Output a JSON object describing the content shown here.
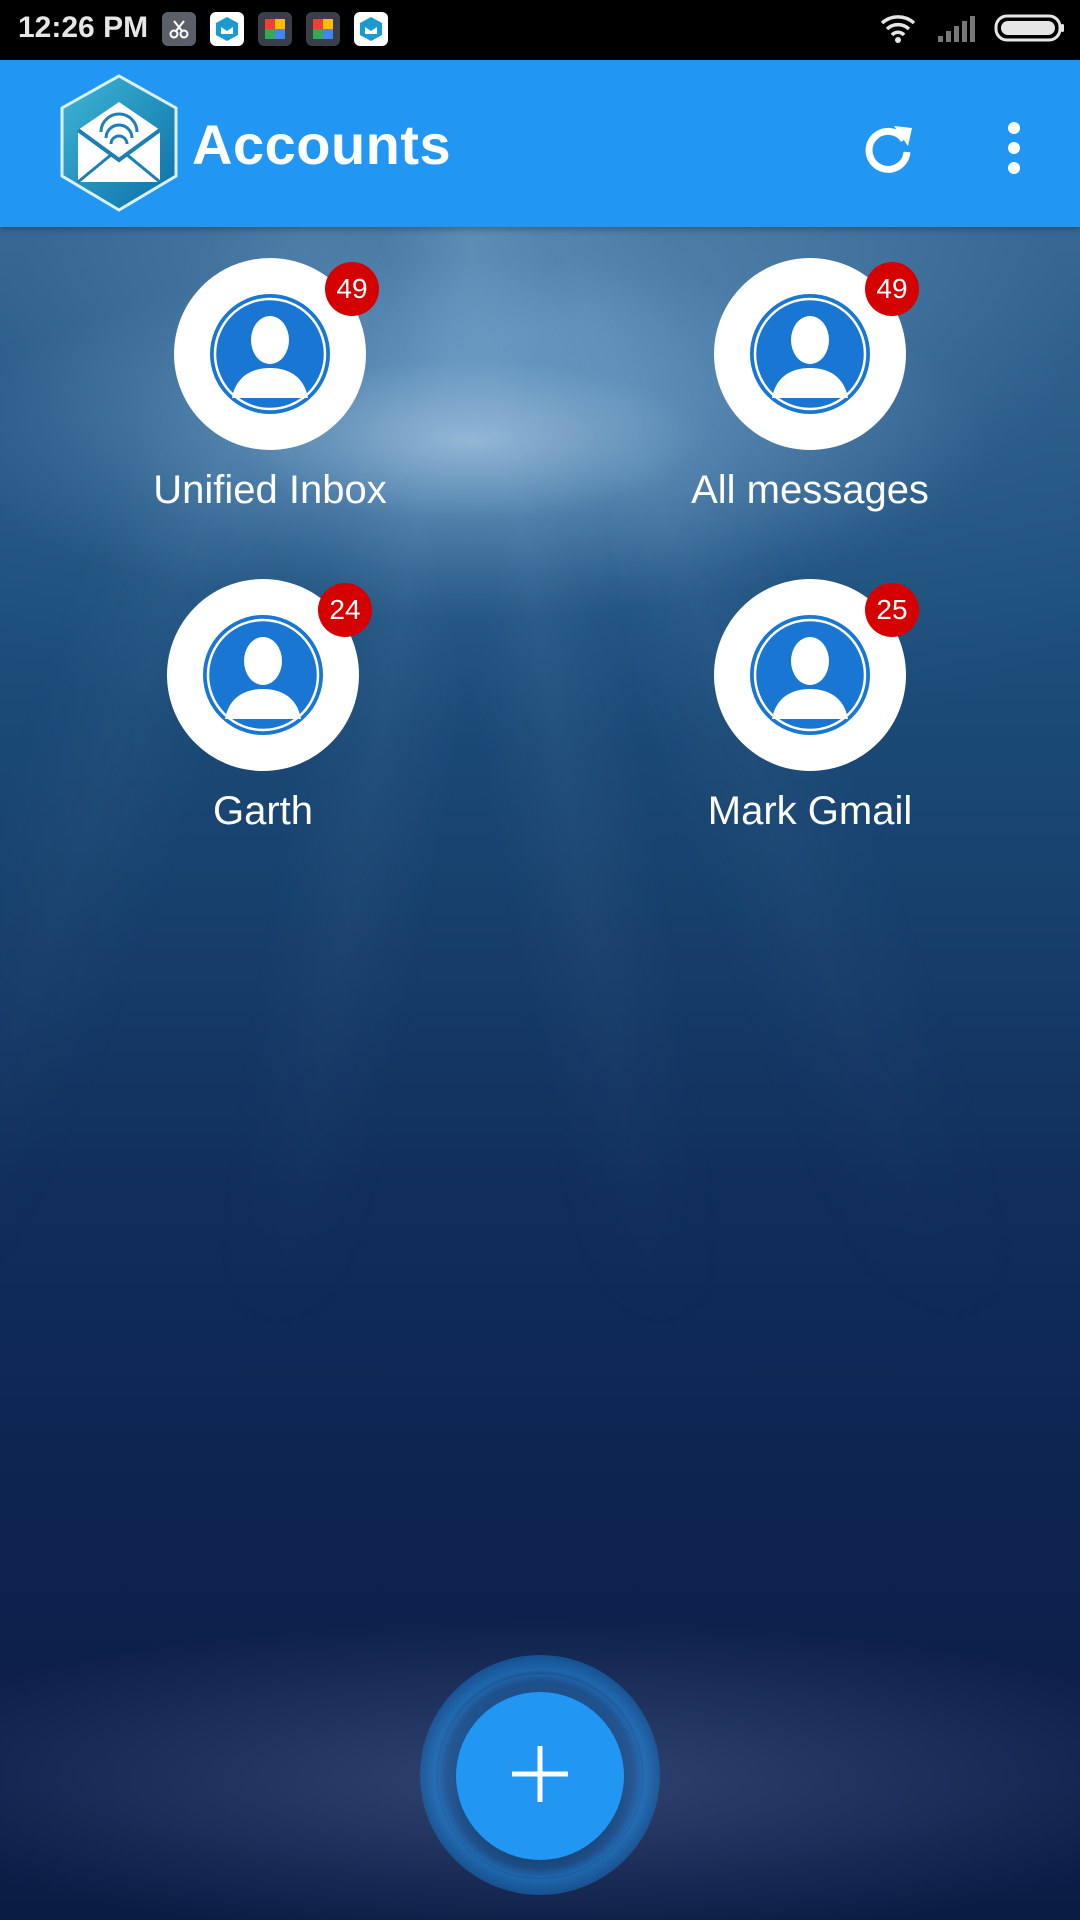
{
  "status_bar": {
    "time": "12:26 PM",
    "notification_icons": [
      "scissors-app-icon",
      "app-logo-icon",
      "puzzle-app-icon",
      "puzzle-app-icon",
      "app-logo-icon"
    ],
    "right_icons": [
      "wifi-icon",
      "signal-icon",
      "battery-icon"
    ]
  },
  "app_bar": {
    "title": "Accounts",
    "actions": [
      "refresh-icon",
      "more-vert-icon"
    ]
  },
  "accounts": [
    {
      "label": "Unified Inbox",
      "count": "49"
    },
    {
      "label": "All messages",
      "count": "49"
    },
    {
      "label": "Garth",
      "count": "24"
    },
    {
      "label": "Mark Gmail",
      "count": "25"
    }
  ],
  "fab": {
    "icon": "plus-icon"
  },
  "colors": {
    "app_bar": "#2196f3",
    "badge": "#d50000",
    "avatar": "#1976d2",
    "fab": "#2196f3"
  }
}
